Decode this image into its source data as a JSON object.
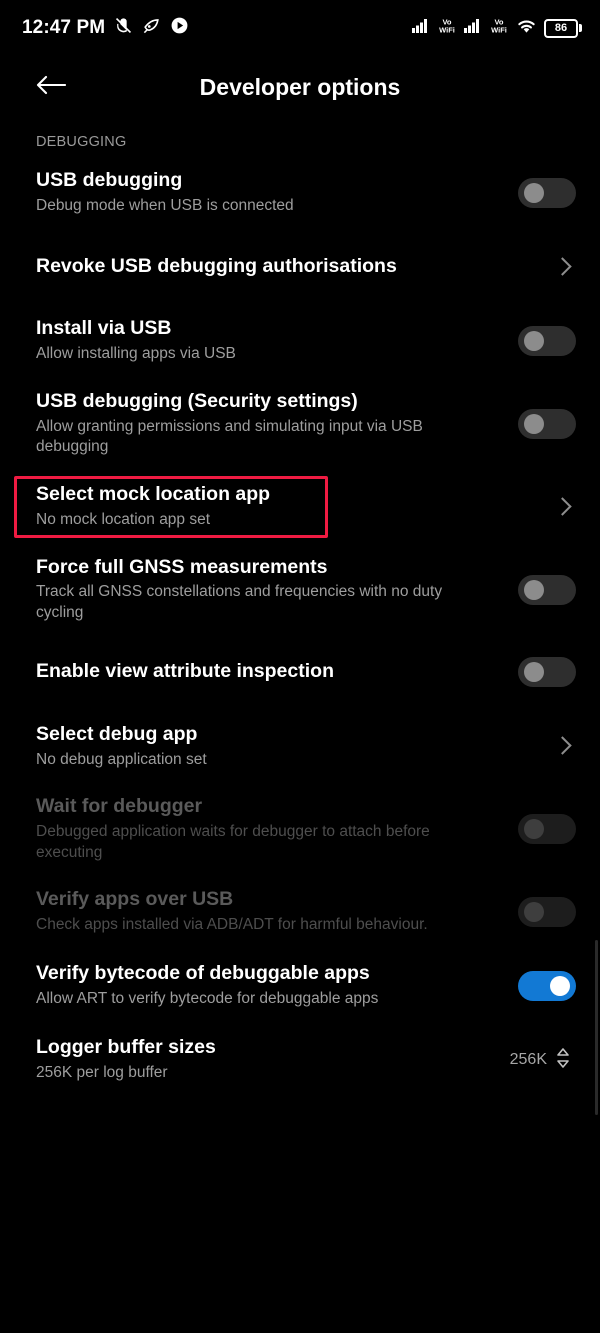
{
  "status_bar": {
    "time": "12:47 PM",
    "left_icons": [
      "mute-icon",
      "data-saver-icon",
      "play-icon"
    ],
    "right_icons": [
      "signal-bars-icon",
      "vowifi-icon",
      "signal-bars-icon",
      "vowifi-icon",
      "wifi-icon"
    ],
    "vowifi_top": "Vo",
    "vowifi_bottom": "WiFi",
    "battery_percent": "86"
  },
  "app_bar": {
    "back_icon": "arrow-left-icon",
    "title": "Developer options"
  },
  "section": {
    "header": "DEBUGGING"
  },
  "colors": {
    "background": "#000000",
    "title_text": "#ffffff",
    "summary_text": "#9e9e9e",
    "disabled_text": "#5a5a5a",
    "toggle_on": "#1279d4",
    "toggle_off_track": "#2e2e2e",
    "toggle_off_knob": "#8c8c8c",
    "highlight_border": "#ef1b42",
    "chevron": "#8d8d8d"
  },
  "highlight": {
    "target": "Select mock location app",
    "border_color": "#ef1b42"
  },
  "rows": [
    {
      "name": "usb-debugging",
      "title": "USB debugging",
      "summary": "Debug mode when USB is connected",
      "accessory": "toggle",
      "toggle_state": "off",
      "disabled": false,
      "highlighted": false
    },
    {
      "name": "revoke-usb-debugging-authorisations",
      "title": "Revoke USB debugging authorisations",
      "summary": "",
      "accessory": "chevron",
      "toggle_state": "",
      "disabled": false,
      "highlighted": false
    },
    {
      "name": "install-via-usb",
      "title": "Install via USB",
      "summary": "Allow installing apps via USB",
      "accessory": "toggle",
      "toggle_state": "off",
      "disabled": false,
      "highlighted": false
    },
    {
      "name": "usb-debugging-security-settings",
      "title": "USB debugging (Security settings)",
      "summary": "Allow granting permissions and simulating input via USB debugging",
      "accessory": "toggle",
      "toggle_state": "off",
      "disabled": false,
      "highlighted": false
    },
    {
      "name": "select-mock-location-app",
      "title": "Select mock location app",
      "summary": "No mock location app set",
      "accessory": "chevron",
      "toggle_state": "",
      "disabled": false,
      "highlighted": true
    },
    {
      "name": "force-full-gnss-measurements",
      "title": "Force full GNSS measurements",
      "summary": "Track all GNSS constellations and frequencies with no duty cycling",
      "accessory": "toggle",
      "toggle_state": "off",
      "disabled": false,
      "highlighted": false
    },
    {
      "name": "enable-view-attribute-inspection",
      "title": "Enable view attribute inspection",
      "summary": "",
      "accessory": "toggle",
      "toggle_state": "off",
      "disabled": false,
      "highlighted": false
    },
    {
      "name": "select-debug-app",
      "title": "Select debug app",
      "summary": "No debug application set",
      "accessory": "chevron",
      "toggle_state": "",
      "disabled": false,
      "highlighted": false
    },
    {
      "name": "wait-for-debugger",
      "title": "Wait for debugger",
      "summary": "Debugged application waits for debugger to attach before executing",
      "accessory": "toggle",
      "toggle_state": "off",
      "disabled": true,
      "highlighted": false
    },
    {
      "name": "verify-apps-over-usb",
      "title": "Verify apps over USB",
      "summary": "Check apps installed via ADB/ADT for harmful behaviour.",
      "accessory": "toggle",
      "toggle_state": "off",
      "disabled": true,
      "highlighted": false
    },
    {
      "name": "verify-bytecode-of-debuggable-apps",
      "title": "Verify bytecode of debuggable apps",
      "summary": "Allow ART to verify bytecode for debuggable apps",
      "accessory": "toggle",
      "toggle_state": "on",
      "disabled": false,
      "highlighted": false
    },
    {
      "name": "logger-buffer-sizes",
      "title": "Logger buffer sizes",
      "summary": "256K per log buffer",
      "accessory": "value-stepper",
      "value": "256K",
      "toggle_state": "",
      "disabled": false,
      "highlighted": false
    }
  ]
}
